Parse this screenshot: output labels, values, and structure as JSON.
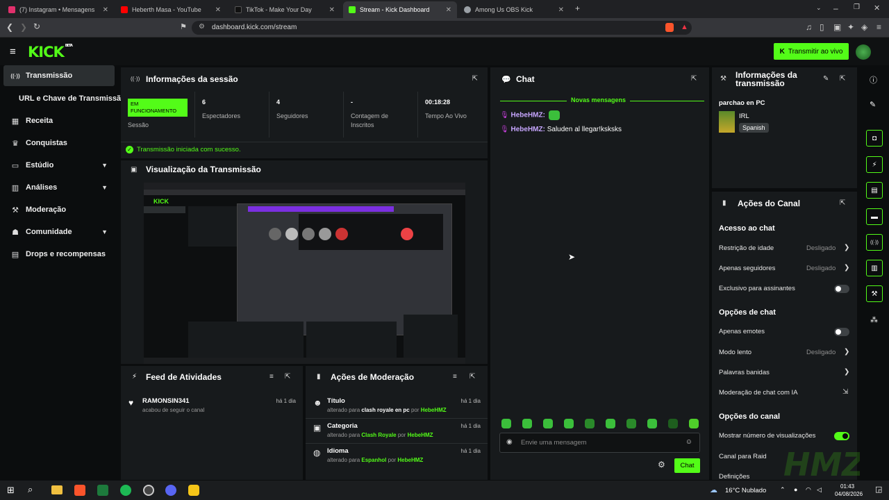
{
  "browser": {
    "tabs": [
      {
        "title": "(7) Instagram • Mensagens",
        "color": "#e1306c"
      },
      {
        "title": "Heberth Masa - YouTube",
        "color": "#ff0000"
      },
      {
        "title": "TikTok - Make Your Day",
        "color": "#111111"
      },
      {
        "title": "Stream - Kick Dashboard",
        "color": "#53fc18"
      },
      {
        "title": "Among Us OBS Kick",
        "color": "#9aa0a6"
      }
    ],
    "url": "dashboard.kick.com/stream"
  },
  "app": {
    "logo": "KICK",
    "logo_tag": "BETA",
    "go_live": "Transmitir ao vivo",
    "accent": "#53fc18",
    "sidebar": [
      {
        "label": "Transmissão",
        "icon": "broadcast-icon",
        "glyph": "((·))"
      },
      {
        "label": "URL e Chave de Transmissão",
        "icon": "",
        "glyph": ""
      },
      {
        "label": "Receita",
        "icon": "revenue-icon",
        "glyph": "▦"
      },
      {
        "label": "Conquistas",
        "icon": "trophy-icon",
        "glyph": "🏆"
      },
      {
        "label": "Estúdio",
        "icon": "studio-icon",
        "glyph": "▭"
      },
      {
        "label": "Análises",
        "icon": "analytics-icon",
        "glyph": "▥"
      },
      {
        "label": "Moderação",
        "icon": "wrench-icon",
        "glyph": "🔧"
      },
      {
        "label": "Comunidade",
        "icon": "community-icon",
        "glyph": "👥"
      },
      {
        "label": "Drops e recompensas",
        "icon": "drops-icon",
        "glyph": "▤"
      }
    ]
  },
  "session": {
    "title": "Informações da sessão",
    "status": "EM FUNCIONAMENTO",
    "status_label": "Sessão",
    "stats": [
      {
        "value": "6",
        "label": "Espectadores"
      },
      {
        "value": "4",
        "label": "Seguidores"
      },
      {
        "value": "-",
        "label": "Contagem de Inscritos"
      },
      {
        "value": "00:18:28",
        "label": "Tempo Ao Vivo"
      }
    ],
    "success": "Transmissão iniciada com sucesso."
  },
  "preview": {
    "title": "Visualização da Transmissão"
  },
  "activity": {
    "title": "Feed de Atividades",
    "items": [
      {
        "user": "RAMONSIN341",
        "text": "acabou de seguir o canal",
        "time": "há 1 dia"
      }
    ]
  },
  "modactions": {
    "title": "Ações de Moderação",
    "items": [
      {
        "field": "Título",
        "prefix": "alterado para ",
        "value": "clash royale en pc",
        "by": " por ",
        "user": "HebeHMZ",
        "time": "há 1 dia",
        "icon": "user-icon",
        "glyph": "👤"
      },
      {
        "field": "Categoria",
        "prefix": "alterado para ",
        "value": "Clash Royale",
        "by": " por ",
        "user": "HebeHMZ",
        "time": "há 1 dia",
        "icon": "category-icon",
        "glyph": "▣"
      },
      {
        "field": "Idioma",
        "prefix": "alterado para ",
        "value": "Espanhol",
        "by": " por ",
        "user": "HebeHMZ",
        "time": "há 1 dia",
        "icon": "globe-icon",
        "glyph": "🌐"
      }
    ]
  },
  "chat": {
    "title": "Chat",
    "new_messages": "Novas mensagens",
    "messages": [
      {
        "user": "HebeHMZ:",
        "text": ""
      },
      {
        "user": "HebeHMZ:",
        "text": "Saluden al llegar!ksksks"
      }
    ],
    "placeholder": "Envie uma mensagem",
    "send": "Chat"
  },
  "stream_info": {
    "title": "Informações da transmissão",
    "stream_title": "parchao en PC",
    "category": "IRL",
    "language": "Spanish"
  },
  "channel_actions": {
    "title": "Ações do Canal",
    "chat_access": "Acesso ao chat",
    "age": "Restrição de idade",
    "age_val": "Desligado",
    "followers": "Apenas seguidores",
    "followers_val": "Desligado",
    "subs": "Exclusivo para assinantes",
    "chat_opts": "Opções de chat",
    "emotes": "Apenas emotes",
    "slow": "Modo lento",
    "slow_val": "Desligado",
    "banned": "Palavras banidas",
    "ai": "Moderação de chat com IA",
    "channel_opts": "Opções do canal",
    "views": "Mostrar número de visualizações",
    "raid": "Canal para Raid",
    "settings": "Definições"
  },
  "watermark": "HMZ",
  "taskbar": {
    "weather": "16°C Nublado",
    "time": "01:43",
    "date": "04/08/2026"
  }
}
